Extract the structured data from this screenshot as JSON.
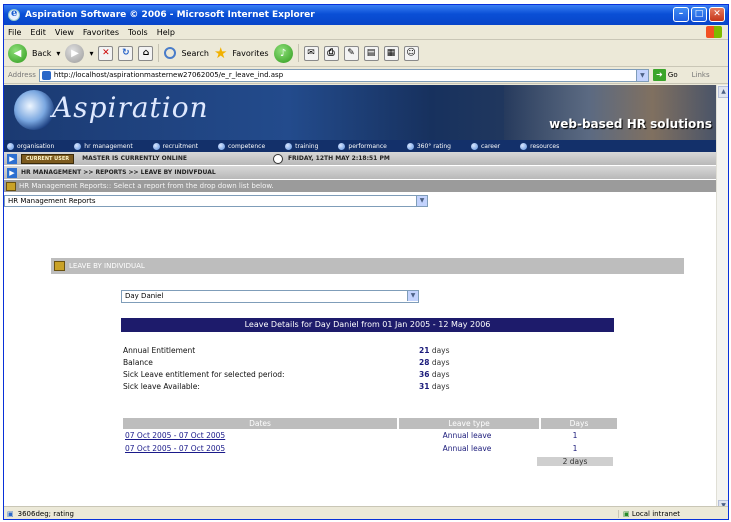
{
  "window": {
    "title": "Aspiration Software © 2006 - Microsoft Internet Explorer",
    "min_label": "–",
    "max_label": "□",
    "close_label": "✕"
  },
  "menu": [
    "File",
    "Edit",
    "View",
    "Favorites",
    "Tools",
    "Help"
  ],
  "toolbar": {
    "back_label": "Back",
    "search_label": "Search",
    "favorites_label": "Favorites"
  },
  "address": {
    "label": "Address",
    "url": "http://localhost/aspirationmasternew27062005/e_r_leave_ind.asp",
    "go_label": "Go",
    "links_label": "Links"
  },
  "banner": {
    "brand": "Aspiration",
    "tagline": "web-based HR solutions"
  },
  "nav": [
    "organisation",
    "hr management",
    "recruitment",
    "competence",
    "training",
    "performance",
    "360° rating",
    "career",
    "resources"
  ],
  "userbar": {
    "badge": "CURRENT USER",
    "status": "MASTER IS CURRENTLY ONLINE",
    "datetime": "FRIDAY, 12TH MAY 2:18:51 PM"
  },
  "breadcrumb": "HR MANAGEMENT >> REPORTS >> LEAVE BY INDIVFDUAL",
  "reports": {
    "bar_text": "HR Management Reports:: Select a report from the drop down list below.",
    "selected": "HR Management Reports"
  },
  "section": {
    "title": "LEAVE BY INDIVIDUAL"
  },
  "employee": {
    "selected": "Day Daniel"
  },
  "leave": {
    "heading": "Leave Details for Day Daniel from 01 Jan 2005 - 12 May 2006",
    "rows": [
      {
        "label": "Annual Entitlement",
        "value": "21",
        "unit": "days"
      },
      {
        "label": "Balance",
        "value": "28",
        "unit": "days"
      },
      {
        "label": "Sick Leave entitlement for selected period:",
        "value": "36",
        "unit": "days"
      },
      {
        "label": "Sick leave Available:",
        "value": "31",
        "unit": "days"
      }
    ]
  },
  "table": {
    "headers": [
      "Dates",
      "Leave type",
      "Days"
    ],
    "rows": [
      {
        "dates": "07 Oct 2005 - 07 Oct 2005",
        "type": "Annual leave",
        "days": "1"
      },
      {
        "dates": "07 Oct 2005 - 07 Oct 2005",
        "type": "Annual leave",
        "days": "1"
      }
    ],
    "total": "2 days"
  },
  "status": {
    "text": "3606deg; rating",
    "zone": "Local intranet"
  }
}
